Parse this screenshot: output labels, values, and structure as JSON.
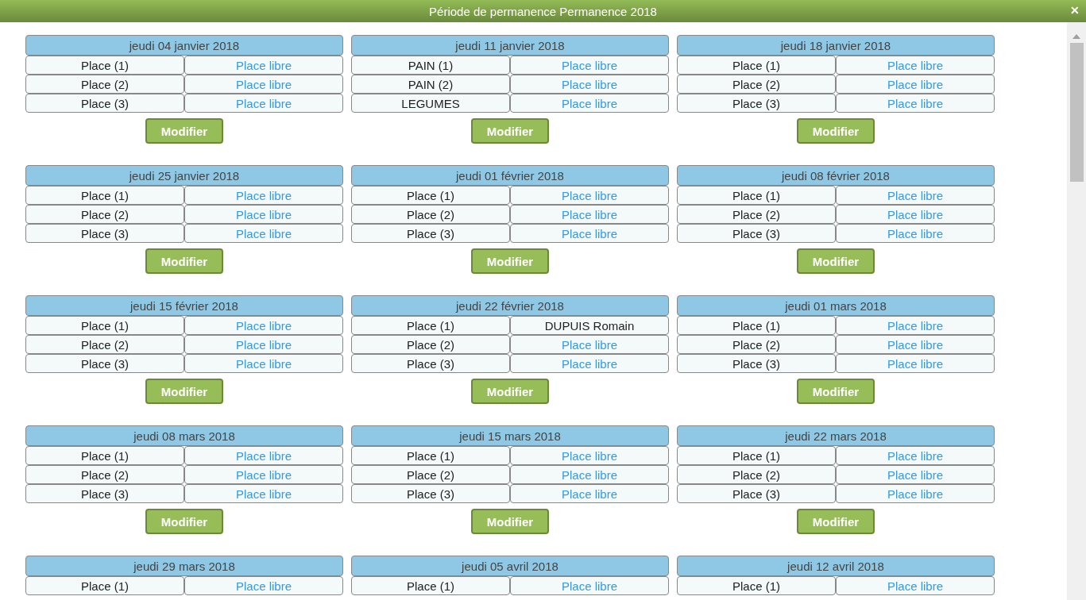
{
  "window": {
    "title": "Période de permanence Permanence 2018",
    "close": "✕"
  },
  "cards": [
    {
      "date": "jeudi 04 janvier 2018",
      "slots": [
        {
          "place": "Place (1)",
          "occupant": "Place libre",
          "free": true
        },
        {
          "place": "Place (2)",
          "occupant": "Place libre",
          "free": true
        },
        {
          "place": "Place (3)",
          "occupant": "Place libre",
          "free": true
        }
      ],
      "button": "Modifier"
    },
    {
      "date": "jeudi 11 janvier 2018",
      "slots": [
        {
          "place": "PAIN (1)",
          "occupant": "Place libre",
          "free": true
        },
        {
          "place": "PAIN (2)",
          "occupant": "Place libre",
          "free": true
        },
        {
          "place": "LEGUMES",
          "occupant": "Place libre",
          "free": true
        }
      ],
      "button": "Modifier"
    },
    {
      "date": "jeudi 18 janvier 2018",
      "slots": [
        {
          "place": "Place (1)",
          "occupant": "Place libre",
          "free": true
        },
        {
          "place": "Place (2)",
          "occupant": "Place libre",
          "free": true
        },
        {
          "place": "Place (3)",
          "occupant": "Place libre",
          "free": true
        }
      ],
      "button": "Modifier"
    },
    {
      "date": "jeudi 25 janvier 2018",
      "slots": [
        {
          "place": "Place (1)",
          "occupant": "Place libre",
          "free": true
        },
        {
          "place": "Place (2)",
          "occupant": "Place libre",
          "free": true
        },
        {
          "place": "Place (3)",
          "occupant": "Place libre",
          "free": true
        }
      ],
      "button": "Modifier"
    },
    {
      "date": "jeudi 01 février 2018",
      "slots": [
        {
          "place": "Place (1)",
          "occupant": "Place libre",
          "free": true
        },
        {
          "place": "Place (2)",
          "occupant": "Place libre",
          "free": true
        },
        {
          "place": "Place (3)",
          "occupant": "Place libre",
          "free": true
        }
      ],
      "button": "Modifier"
    },
    {
      "date": "jeudi 08 février 2018",
      "slots": [
        {
          "place": "Place (1)",
          "occupant": "Place libre",
          "free": true
        },
        {
          "place": "Place (2)",
          "occupant": "Place libre",
          "free": true
        },
        {
          "place": "Place (3)",
          "occupant": "Place libre",
          "free": true
        }
      ],
      "button": "Modifier"
    },
    {
      "date": "jeudi 15 février 2018",
      "slots": [
        {
          "place": "Place (1)",
          "occupant": "Place libre",
          "free": true
        },
        {
          "place": "Place (2)",
          "occupant": "Place libre",
          "free": true
        },
        {
          "place": "Place (3)",
          "occupant": "Place libre",
          "free": true
        }
      ],
      "button": "Modifier"
    },
    {
      "date": "jeudi 22 février 2018",
      "slots": [
        {
          "place": "Place (1)",
          "occupant": "DUPUIS Romain",
          "free": false
        },
        {
          "place": "Place (2)",
          "occupant": "Place libre",
          "free": true
        },
        {
          "place": "Place (3)",
          "occupant": "Place libre",
          "free": true
        }
      ],
      "button": "Modifier"
    },
    {
      "date": "jeudi 01 mars 2018",
      "slots": [
        {
          "place": "Place (1)",
          "occupant": "Place libre",
          "free": true
        },
        {
          "place": "Place (2)",
          "occupant": "Place libre",
          "free": true
        },
        {
          "place": "Place (3)",
          "occupant": "Place libre",
          "free": true
        }
      ],
      "button": "Modifier"
    },
    {
      "date": "jeudi 08 mars 2018",
      "slots": [
        {
          "place": "Place (1)",
          "occupant": "Place libre",
          "free": true
        },
        {
          "place": "Place (2)",
          "occupant": "Place libre",
          "free": true
        },
        {
          "place": "Place (3)",
          "occupant": "Place libre",
          "free": true
        }
      ],
      "button": "Modifier"
    },
    {
      "date": "jeudi 15 mars 2018",
      "slots": [
        {
          "place": "Place (1)",
          "occupant": "Place libre",
          "free": true
        },
        {
          "place": "Place (2)",
          "occupant": "Place libre",
          "free": true
        },
        {
          "place": "Place (3)",
          "occupant": "Place libre",
          "free": true
        }
      ],
      "button": "Modifier"
    },
    {
      "date": "jeudi 22 mars 2018",
      "slots": [
        {
          "place": "Place (1)",
          "occupant": "Place libre",
          "free": true
        },
        {
          "place": "Place (2)",
          "occupant": "Place libre",
          "free": true
        },
        {
          "place": "Place (3)",
          "occupant": "Place libre",
          "free": true
        }
      ],
      "button": "Modifier"
    },
    {
      "date": "jeudi 29 mars 2018",
      "slots": [
        {
          "place": "Place (1)",
          "occupant": "Place libre",
          "free": true
        }
      ]
    },
    {
      "date": "jeudi 05 avril 2018",
      "slots": [
        {
          "place": "Place (1)",
          "occupant": "Place libre",
          "free": true
        }
      ]
    },
    {
      "date": "jeudi 12 avril 2018",
      "slots": [
        {
          "place": "Place (1)",
          "occupant": "Place libre",
          "free": true
        }
      ]
    }
  ]
}
